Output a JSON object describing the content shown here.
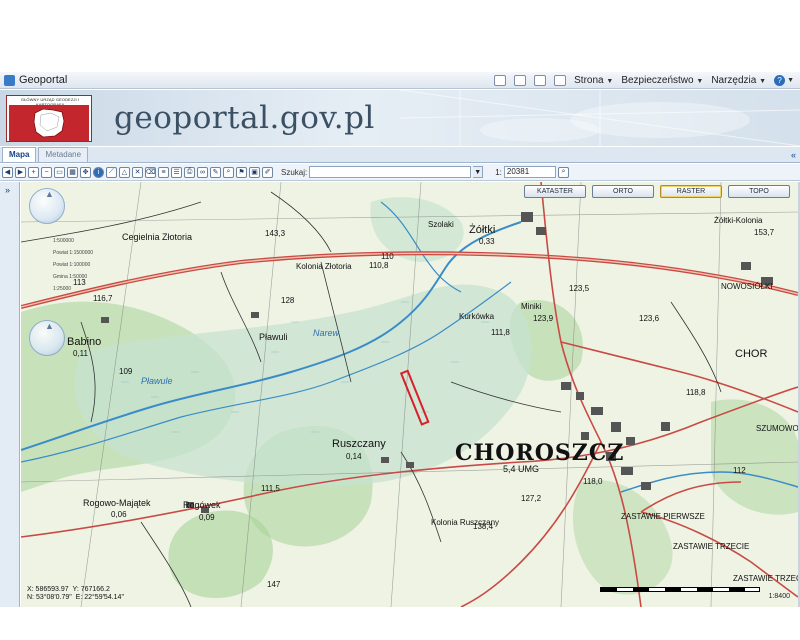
{
  "browser": {
    "tab_title": "Geoportal",
    "menu": [
      "Strona",
      "Bezpieczeństwo",
      "Narzędzia"
    ],
    "help": "?"
  },
  "banner": {
    "logo_text": "GŁÓWNY URZĄD GEODEZJI I KARTOGRAFII",
    "site_title": "geoportal.gov.pl"
  },
  "tabs": [
    {
      "label": "Mapa"
    },
    {
      "label": "Metadane"
    }
  ],
  "collapse_icon": "«",
  "expand_icon": "»",
  "toolbar": {
    "search_label": "Szukaj:",
    "search_value": "",
    "scale_label": "1:",
    "scale_value": "20381"
  },
  "layers": [
    "KATASTER",
    "ORTO",
    "RASTER",
    "TOPO"
  ],
  "active_layer": "RASTER",
  "zoom_levels": [
    "1:500000",
    "Powiat 1:1500000",
    "Powiat 1:100000",
    "Gmina 1:50000",
    "1:25000"
  ],
  "map_labels": {
    "choroszcz": "CHOROSZCZ",
    "choroszcz_sub": "5,4 UMG",
    "zoltki": "Żółtki",
    "zoltki_val": "0,33",
    "zoltki_kolonia": "Żółtki-Kolonia",
    "cegielnia": "Cegielnia Złotoria",
    "kolonia_zlotoria": "Kolonia Złotoria",
    "babino": "Babino",
    "babino_val": "0,11",
    "pawuly": "Pławuli",
    "ruszczany": "Ruszczany",
    "ruszczany_val": "0,14",
    "rogowo": "Rogowo-Majątek",
    "rogowo_val": "0,06",
    "rogowek": "Rogówek",
    "rogowek_val": "0,09",
    "kolonia_ruszczany": "Kolonia Ruszczany",
    "narew": "Narew",
    "nowosiolki": "NOWOSIÓŁKI",
    "choro_right": "CHOR",
    "zastawie1": "ZASTAWIE PIERWSZE",
    "zastawie3": "ZASTAWIE TRZECIE",
    "zastawie_trzec": "ZASTAWIE TRZEC",
    "szumowo": "SZUMOWO",
    "szolaki": "Szolaki",
    "miniki": "Miniki",
    "plawule": "Pławule",
    "kurkowka": "Kurkówka",
    "v1433": "143,3",
    "v1108": "110,8",
    "v1235": "123,5",
    "v1239": "123,9",
    "v1236": "123,6",
    "v1118": "111,8",
    "v1188": "118,8",
    "v1115": "111,5",
    "v1273": "127,2",
    "v1180": "118,0",
    "v1384": "138,4",
    "v1537": "153,7",
    "v128": "128",
    "v109": "109",
    "v110": "110",
    "v112": "112",
    "v113": "113",
    "v1167": "116,7",
    "v147": "147"
  },
  "coords": {
    "x": "X: 586593.97",
    "y": "Y: 767166.2",
    "n": "N: 53°08'0.79\"",
    "e": "E: 22°59'54.14\""
  },
  "scale_text": "1:8400",
  "colors": {
    "logo_red": "#c4262e",
    "road": "#c94a44",
    "water": "#3a8cc8",
    "forest": "#9cc98a",
    "marsh": "#bcdcc4",
    "parcel": "#d8202a"
  }
}
